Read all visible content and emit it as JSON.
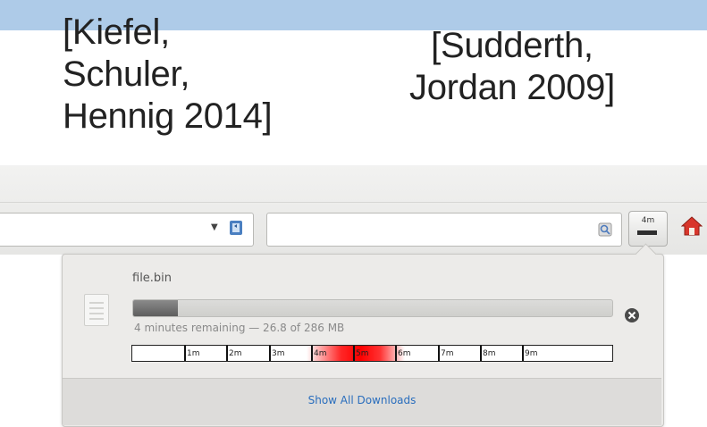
{
  "slide": {
    "citation_left": "[Kiefel,\nSchuler,\nHennig 2014]",
    "citation_right": "[Sudderth,\nJordan 2009]"
  },
  "toolbar": {
    "download_button_time": "4m",
    "download_button_progress": 0.09
  },
  "downloads_panel": {
    "item": {
      "file_name": "file.bin",
      "progress": 0.094,
      "status": "4 minutes remaining — 26.8 of 286 MB",
      "timeline_labels": [
        "1m",
        "2m",
        "3m",
        "4m",
        "5m",
        "6m",
        "7m",
        "8m",
        "9m"
      ]
    },
    "show_all_label": "Show All Downloads"
  },
  "colors": {
    "slide_band": "#aecbe8",
    "link": "#2a6ebd",
    "timeline_highlight": "#ff0000"
  }
}
